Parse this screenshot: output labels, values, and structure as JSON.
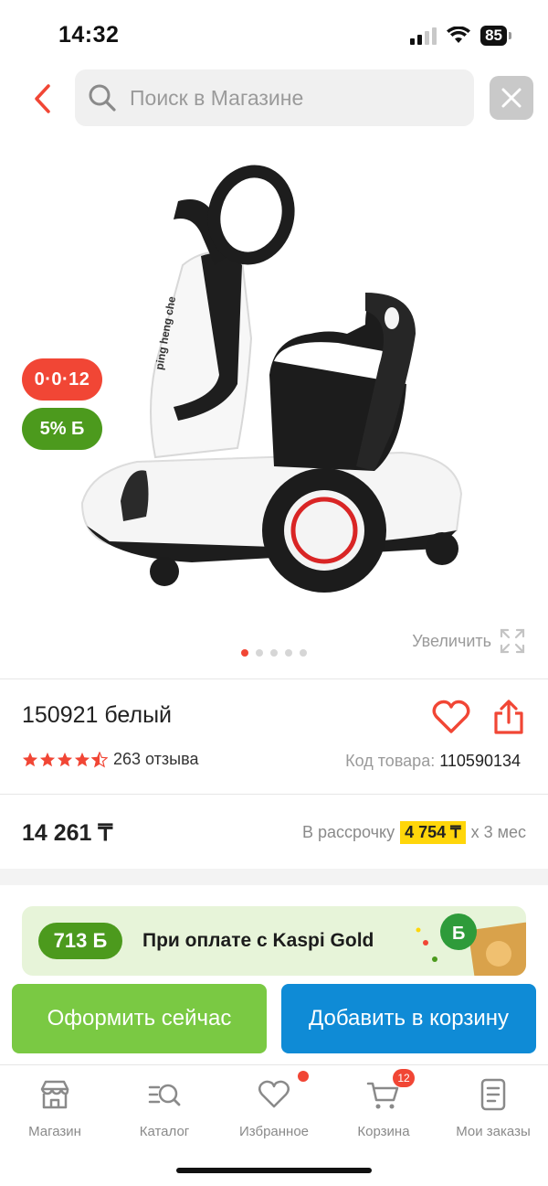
{
  "status_bar": {
    "time": "14:32",
    "battery": "85"
  },
  "search": {
    "placeholder": "Поиск в Магазине"
  },
  "gallery": {
    "badges": {
      "installment": "0·0·12",
      "bonus": "5% Б"
    },
    "zoom_label": "Увеличить",
    "image_count": 5,
    "active_image": 1
  },
  "product": {
    "title": "150921 белый",
    "rating": 4.5,
    "reviews": "263 отзыва",
    "sku_label": "Код товара:",
    "sku_value": "110590134"
  },
  "price": {
    "value": "14 261 ₸",
    "installment_prefix": "В рассрочку",
    "installment_amount": "4 754 ₸",
    "installment_suffix": "х 3 мес"
  },
  "gold_banner": {
    "bonus": "713 Б",
    "text": "При оплате с Kaspi Gold"
  },
  "actions": {
    "buy_now": "Оформить сейчас",
    "add_to_cart": "Добавить в корзину"
  },
  "tabbar": {
    "items": [
      {
        "label": "Магазин",
        "icon": "store-icon"
      },
      {
        "label": "Каталог",
        "icon": "catalog-search-icon"
      },
      {
        "label": "Избранное",
        "icon": "heart-icon"
      },
      {
        "label": "Корзина",
        "icon": "cart-icon",
        "badge": "12"
      },
      {
        "label": "Мои заказы",
        "icon": "orders-icon"
      }
    ]
  },
  "colors": {
    "accent_red": "#f14635",
    "bonus_green": "#4c9a1d",
    "buy_green": "#7ac943",
    "cart_blue": "#0f8bd6",
    "installment_yellow": "#ffd60a"
  }
}
